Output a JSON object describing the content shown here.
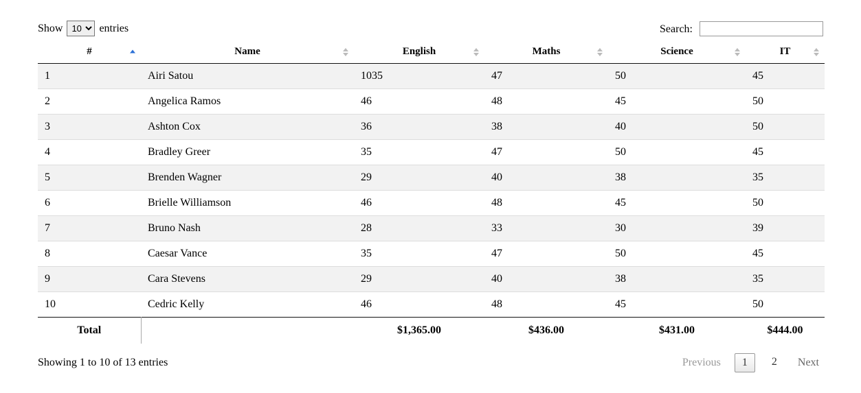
{
  "length": {
    "prefix": "Show",
    "selected": "10",
    "suffix": "entries"
  },
  "search": {
    "label": "Search:",
    "value": ""
  },
  "columns": {
    "idx": "#",
    "name": "Name",
    "english": "English",
    "maths": "Maths",
    "science": "Science",
    "it": "IT"
  },
  "rows": [
    {
      "idx": "1",
      "name": "Airi Satou",
      "english": "1035",
      "maths": "47",
      "science": "50",
      "it": "45"
    },
    {
      "idx": "2",
      "name": "Angelica Ramos",
      "english": "46",
      "maths": "48",
      "science": "45",
      "it": "50"
    },
    {
      "idx": "3",
      "name": "Ashton Cox",
      "english": "36",
      "maths": "38",
      "science": "40",
      "it": "50"
    },
    {
      "idx": "4",
      "name": "Bradley Greer",
      "english": "35",
      "maths": "47",
      "science": "50",
      "it": "45"
    },
    {
      "idx": "5",
      "name": "Brenden Wagner",
      "english": "29",
      "maths": "40",
      "science": "38",
      "it": "35"
    },
    {
      "idx": "6",
      "name": "Brielle Williamson",
      "english": "46",
      "maths": "48",
      "science": "45",
      "it": "50"
    },
    {
      "idx": "7",
      "name": "Bruno Nash",
      "english": "28",
      "maths": "33",
      "science": "30",
      "it": "39"
    },
    {
      "idx": "8",
      "name": "Caesar Vance",
      "english": "35",
      "maths": "47",
      "science": "50",
      "it": "45"
    },
    {
      "idx": "9",
      "name": "Cara Stevens",
      "english": "29",
      "maths": "40",
      "science": "38",
      "it": "35"
    },
    {
      "idx": "10",
      "name": "Cedric Kelly",
      "english": "46",
      "maths": "48",
      "science": "45",
      "it": "50"
    }
  ],
  "footer": {
    "total_label": "Total",
    "english": "$1,365.00",
    "maths": "$436.00",
    "science": "$431.00",
    "it": "$444.00"
  },
  "info": "Showing 1 to 10 of 13 entries",
  "paginate": {
    "previous": "Previous",
    "next": "Next",
    "pages": [
      "1",
      "2"
    ],
    "current": "1"
  }
}
